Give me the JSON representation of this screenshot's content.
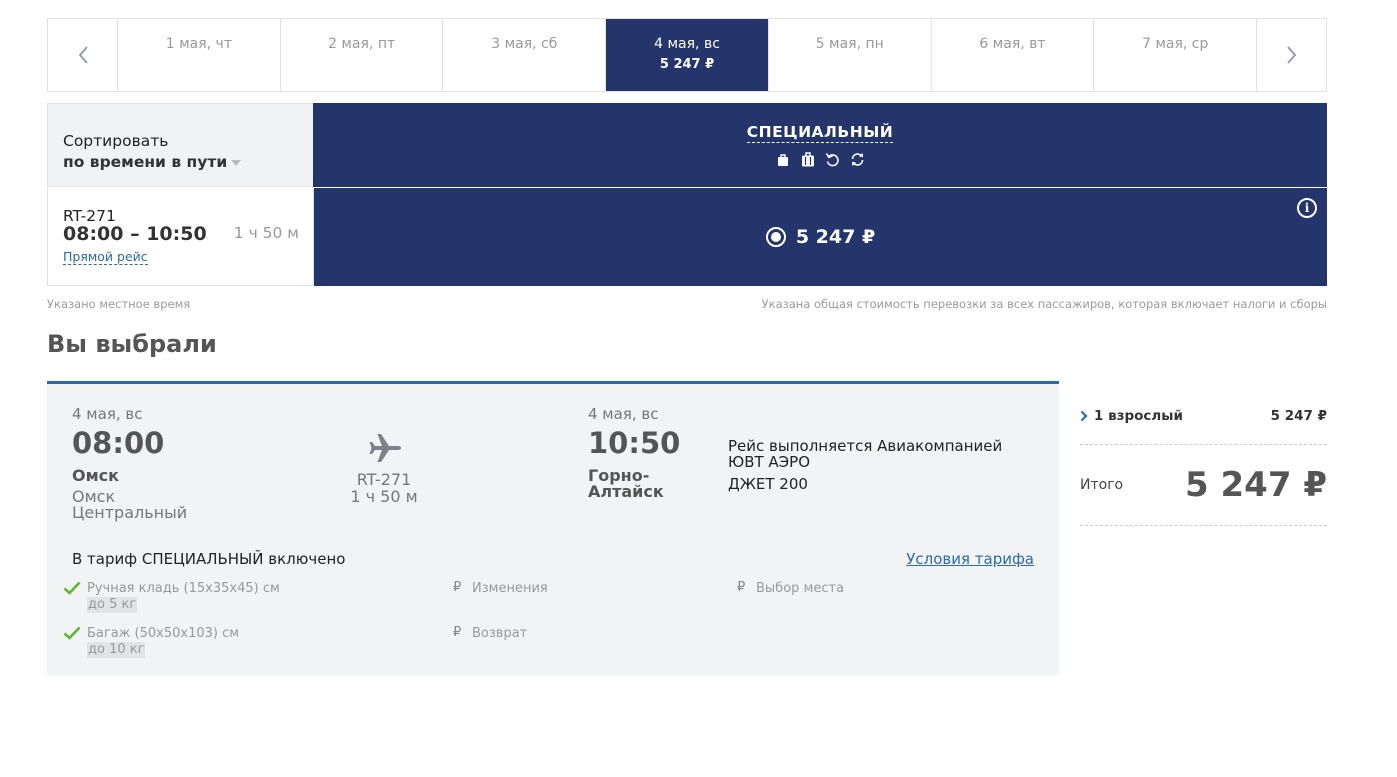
{
  "date_strip": {
    "prev_icon": "chevron-left-icon",
    "next_icon": "chevron-right-icon",
    "dates": [
      {
        "label": "1 мая, чт",
        "price": ""
      },
      {
        "label": "2 мая, пт",
        "price": ""
      },
      {
        "label": "3 мая, сб",
        "price": ""
      },
      {
        "label": "4 мая, вс",
        "price": "5 247 ₽"
      },
      {
        "label": "5 мая, пн",
        "price": ""
      },
      {
        "label": "6 мая, вт",
        "price": ""
      },
      {
        "label": "7 мая, ср",
        "price": ""
      }
    ],
    "active_index": 3,
    "active_color": "#23356b"
  },
  "sort": {
    "label": "Сортировать",
    "value": "по времени в пути"
  },
  "fare_column": {
    "name": "СПЕЦИАЛЬНЫЙ",
    "icons": [
      "bag-icon",
      "luggage-icon",
      "refund-icon",
      "exchange-icon"
    ]
  },
  "flight": {
    "number": "RT-271",
    "times": "08:00 – 10:50",
    "duration": "1 ч 50 м",
    "type": "Прямой рейс",
    "price": "5 247 ₽"
  },
  "notes": {
    "local_time": "Указано местное время",
    "total_cost": "Указана общая стоимость перевозки за всех пассажиров, которая включает налоги и сборы"
  },
  "selected": {
    "title": "Вы выбрали",
    "accent": "#2c6aa1",
    "departure": {
      "date": "4 мая, вс",
      "time": "08:00",
      "city": "Омск",
      "airport_line1": "Омск",
      "airport_line2": "Центральный"
    },
    "middle": {
      "number": "RT-271",
      "duration": "1 ч 50 м"
    },
    "arrival": {
      "date": "4 мая, вс",
      "time": "10:50",
      "city_line1": "Горно-",
      "city_line2": "Алтайск"
    },
    "carrier": "Рейс выполняется Авиакомпанией ЮВТ АЭРО",
    "aircraft": "ДЖЕТ 200",
    "tariff_title": "В тариф СПЕЦИАЛЬНЫЙ включено",
    "tariff_link": "Условия тарифа",
    "features": {
      "hand_bag": {
        "label": "Ручная кладь (15x35x45) см",
        "sub": "до 5 кг"
      },
      "baggage": {
        "label": "Багаж (50x50x103) см",
        "sub": "до 10 кг"
      },
      "changes": "Изменения",
      "refund": "Возврат",
      "seat": "Выбор места"
    },
    "currency_symbol": "₽"
  },
  "summary": {
    "pax_label": "1 взрослый",
    "pax_price": "5 247 ₽",
    "total_label": "Итого",
    "total_price": "5 247 ₽"
  }
}
